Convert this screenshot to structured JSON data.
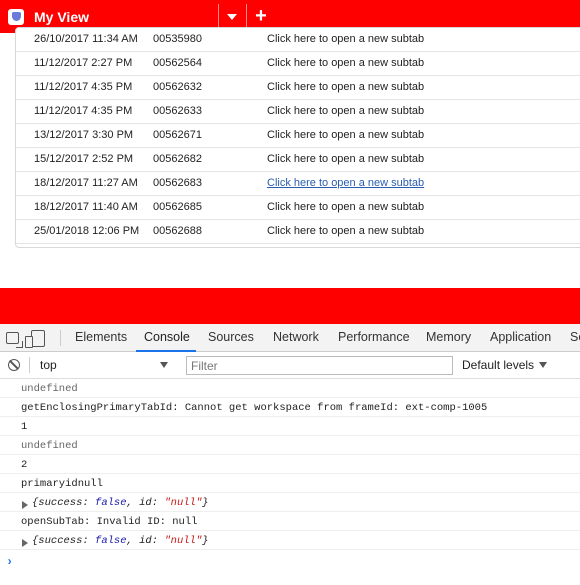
{
  "topbar": {
    "title": "My View",
    "add_label": "+"
  },
  "table": {
    "rows": [
      {
        "date": "26/10/2017 11:34 AM",
        "number": "00535980",
        "link": "Click here to open a new subtab"
      },
      {
        "date": "11/12/2017 2:27 PM",
        "number": "00562564",
        "link": "Click here to open a new subtab"
      },
      {
        "date": "11/12/2017 4:35 PM",
        "number": "00562632",
        "link": "Click here to open a new subtab"
      },
      {
        "date": "11/12/2017 4:35 PM",
        "number": "00562633",
        "link": "Click here to open a new subtab"
      },
      {
        "date": "13/12/2017 3:30 PM",
        "number": "00562671",
        "link": "Click here to open a new subtab"
      },
      {
        "date": "15/12/2017 2:52 PM",
        "number": "00562682",
        "link": "Click here to open a new subtab"
      },
      {
        "date": "18/12/2017 11:27 AM",
        "number": "00562683",
        "link": "Click here to open a new subtab"
      },
      {
        "date": "18/12/2017 11:40 AM",
        "number": "00562685",
        "link": "Click here to open a new subtab"
      },
      {
        "date": "25/01/2018 12:06 PM",
        "number": "00562688",
        "link": "Click here to open a new subtab"
      }
    ]
  },
  "devtools": {
    "tabs": [
      "Elements",
      "Console",
      "Sources",
      "Network",
      "Performance",
      "Memory",
      "Application",
      "Se"
    ],
    "active_tab": "Console",
    "context": "top",
    "filter_placeholder": "Filter",
    "levels_label": "Default levels",
    "console_lines": [
      {
        "text": "undefined",
        "gray": true
      },
      {
        "text": "getEnclosingPrimaryTabId: Cannot get workspace from frameId: ext-comp-1005"
      },
      {
        "text": "1"
      },
      {
        "text": "undefined",
        "gray": true
      },
      {
        "text": "2"
      },
      {
        "text": "primaryidnull"
      },
      {
        "object": true,
        "prefix": "{success: ",
        "bool": "false",
        "mid": ", id: ",
        "str": "\"null\"",
        "suffix": "}"
      },
      {
        "text": "openSubTab: Invalid ID: null"
      },
      {
        "object": true,
        "prefix": "{success: ",
        "bool": "false",
        "mid": ", id: ",
        "str": "\"null\"",
        "suffix": "}"
      }
    ],
    "prompt_symbol": "›"
  },
  "colors": {
    "brand_red": "#ff0000",
    "devtools_accent": "#1a73e8"
  }
}
